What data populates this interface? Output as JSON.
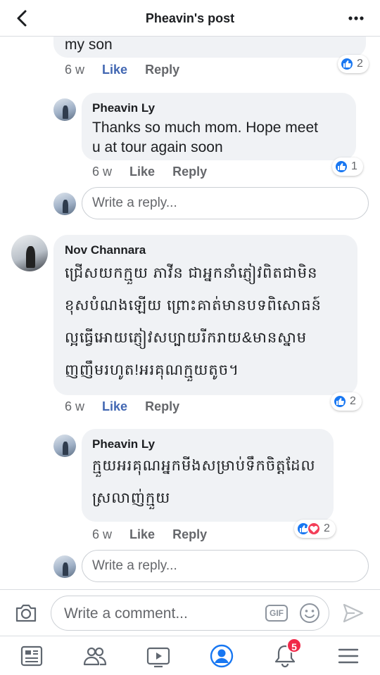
{
  "header": {
    "title": "Pheavin's post"
  },
  "thread": {
    "top_comment": {
      "text_tail": "my son",
      "time": "6 w",
      "like": "Like",
      "reply": "Reply",
      "reactions": "2"
    },
    "reply1": {
      "author": "Pheavin Ly",
      "line1": "Thanks so much mom. Hope meet",
      "line2": "u at tour again soon",
      "time": "6 w",
      "like": "Like",
      "reply": "Reply",
      "reactions": "1"
    },
    "reply_box1": {
      "placeholder": "Write a reply..."
    },
    "comment2": {
      "author": "Nov Channara",
      "line1": "ជ្រើសយកក្មួយ ភាវីន ជាអ្នកនាំភ្ញៀវពិតជាមិន",
      "line2": "ខុសបំណងឡើយ ព្រោះគាត់មានបទពិសោធន៍",
      "line3": "ល្អធ្វើអោយភ្ញៀវសប្បាយរីករាយ&មានស្នាម",
      "line4": "ញញឹមរហូត!អរគុណក្មួយតូច។",
      "time": "6 w",
      "like": "Like",
      "reply": "Reply",
      "reactions": "2"
    },
    "reply2": {
      "author": "Pheavin Ly",
      "line1": "ក្មួយអរគុណអ្នកមីងសម្រាប់ទឹកចិត្តដែល",
      "line2": "ស្រលាញ់ក្មួយ",
      "time": "6 w",
      "like": "Like",
      "reply": "Reply",
      "reactions": "2"
    },
    "reply_box2": {
      "placeholder": "Write a reply..."
    }
  },
  "composer": {
    "placeholder": "Write a comment...",
    "gif_label": "GIF"
  },
  "tabbar": {
    "notifications_badge": "5"
  },
  "colors": {
    "like_blue": "#4267b2",
    "reaction_blue": "#1877f2",
    "love_red": "#f33e58",
    "badge_red": "#f02849",
    "bubble_gray": "#f0f2f5"
  },
  "icons": [
    "back-arrow-icon",
    "more-icon",
    "camera-icon",
    "gif-icon",
    "emoji-icon",
    "send-icon",
    "news-feed-icon",
    "groups-icon",
    "watch-icon",
    "profile-icon",
    "notifications-icon",
    "menu-icon",
    "like-reaction-icon",
    "love-reaction-icon"
  ]
}
